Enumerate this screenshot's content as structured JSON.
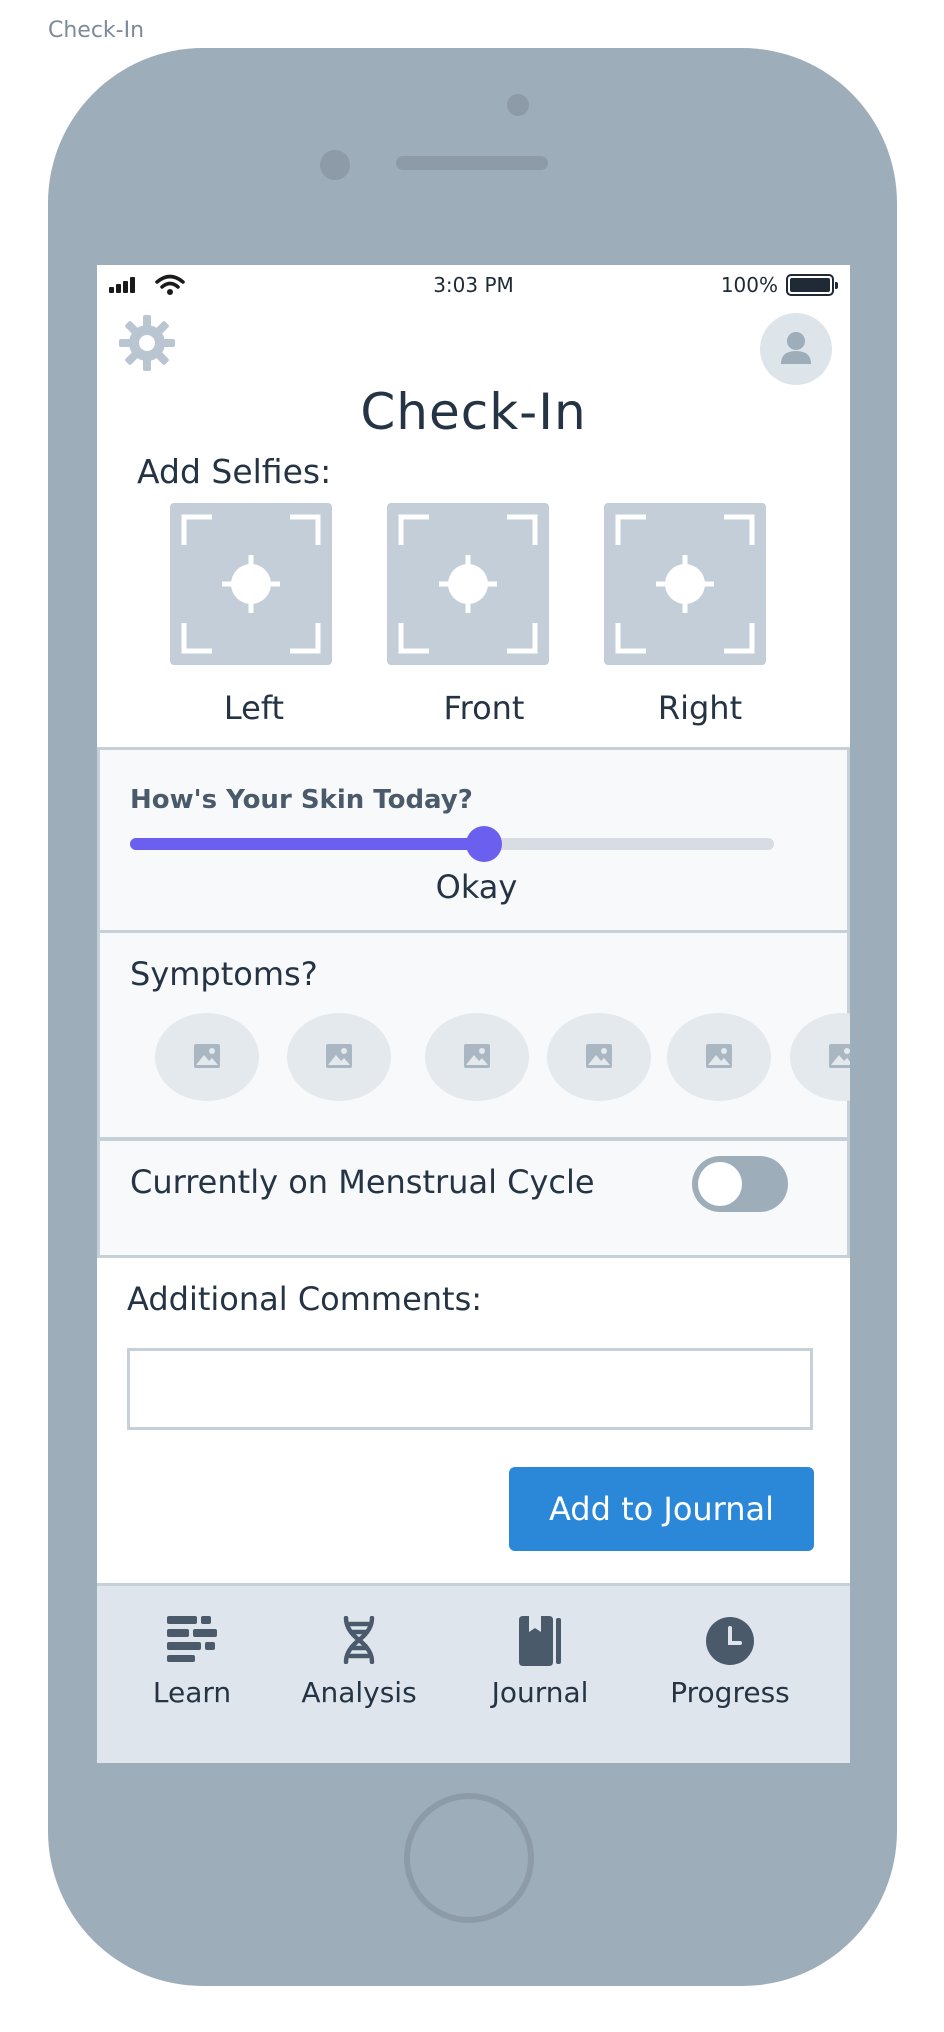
{
  "board": {
    "label": "Check-In"
  },
  "status_bar": {
    "time": "3:03 PM",
    "battery": "100%"
  },
  "header": {
    "title": "Check-In",
    "settings_icon": "gear-icon",
    "profile_icon": "user-icon"
  },
  "selfies": {
    "label": "Add Selfies:",
    "slots": [
      {
        "label": "Left",
        "icon": "camera-focus-icon"
      },
      {
        "label": "Front",
        "icon": "camera-focus-icon"
      },
      {
        "label": "Right",
        "icon": "camera-focus-icon"
      }
    ]
  },
  "skin": {
    "question": "How's Your Skin Today?",
    "value_label": "Okay",
    "level": 0.55,
    "accent": "#6b5ff0"
  },
  "symptoms": {
    "label": "Symptoms?",
    "chips": [
      {
        "icon": "image-icon"
      },
      {
        "icon": "image-icon"
      },
      {
        "icon": "image-icon"
      },
      {
        "icon": "image-icon"
      },
      {
        "icon": "image-icon"
      },
      {
        "icon": "image-icon"
      }
    ]
  },
  "menstrual": {
    "label": "Currently on Menstrual Cycle",
    "on": false
  },
  "comments": {
    "label": "Additional Comments:",
    "value": "",
    "placeholder": ""
  },
  "actions": {
    "add_journal": "Add to Journal",
    "accent": "#2b88d9"
  },
  "tabs": [
    {
      "label": "Learn",
      "icon": "learn-icon"
    },
    {
      "label": "Analysis",
      "icon": "dna-icon"
    },
    {
      "label": "Journal",
      "icon": "book-icon"
    },
    {
      "label": "Progress",
      "icon": "clock-icon"
    }
  ]
}
